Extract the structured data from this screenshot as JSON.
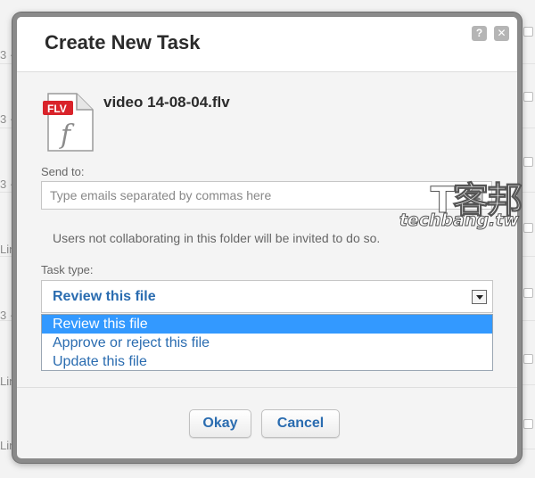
{
  "background": {
    "fragments": [
      "3 · l",
      "3 · l",
      "3 · l",
      "Lin",
      "3 · l",
      "Lin",
      "Lin"
    ]
  },
  "dialog": {
    "title": "Create New Task",
    "help_label": "?",
    "close_label": "✕",
    "file": {
      "badge": "FLV",
      "name": "video 14-08-04.flv"
    },
    "send_to": {
      "label": "Send to:",
      "value": "",
      "placeholder": "Type emails separated by commas here"
    },
    "invite_note": "Users not collaborating in this folder will be invited to do so.",
    "task_type": {
      "label": "Task type:",
      "selected": "Review this file",
      "options": [
        "Review this file",
        "Approve or reject this file",
        "Update this file"
      ]
    },
    "buttons": {
      "ok": "Okay",
      "cancel": "Cancel"
    }
  },
  "watermark": {
    "logo": "T客邦",
    "text": "techbang.tw"
  },
  "colors": {
    "link_blue": "#2a6cb0",
    "selected_bg": "#3399ff",
    "badge_red": "#d9232a"
  }
}
